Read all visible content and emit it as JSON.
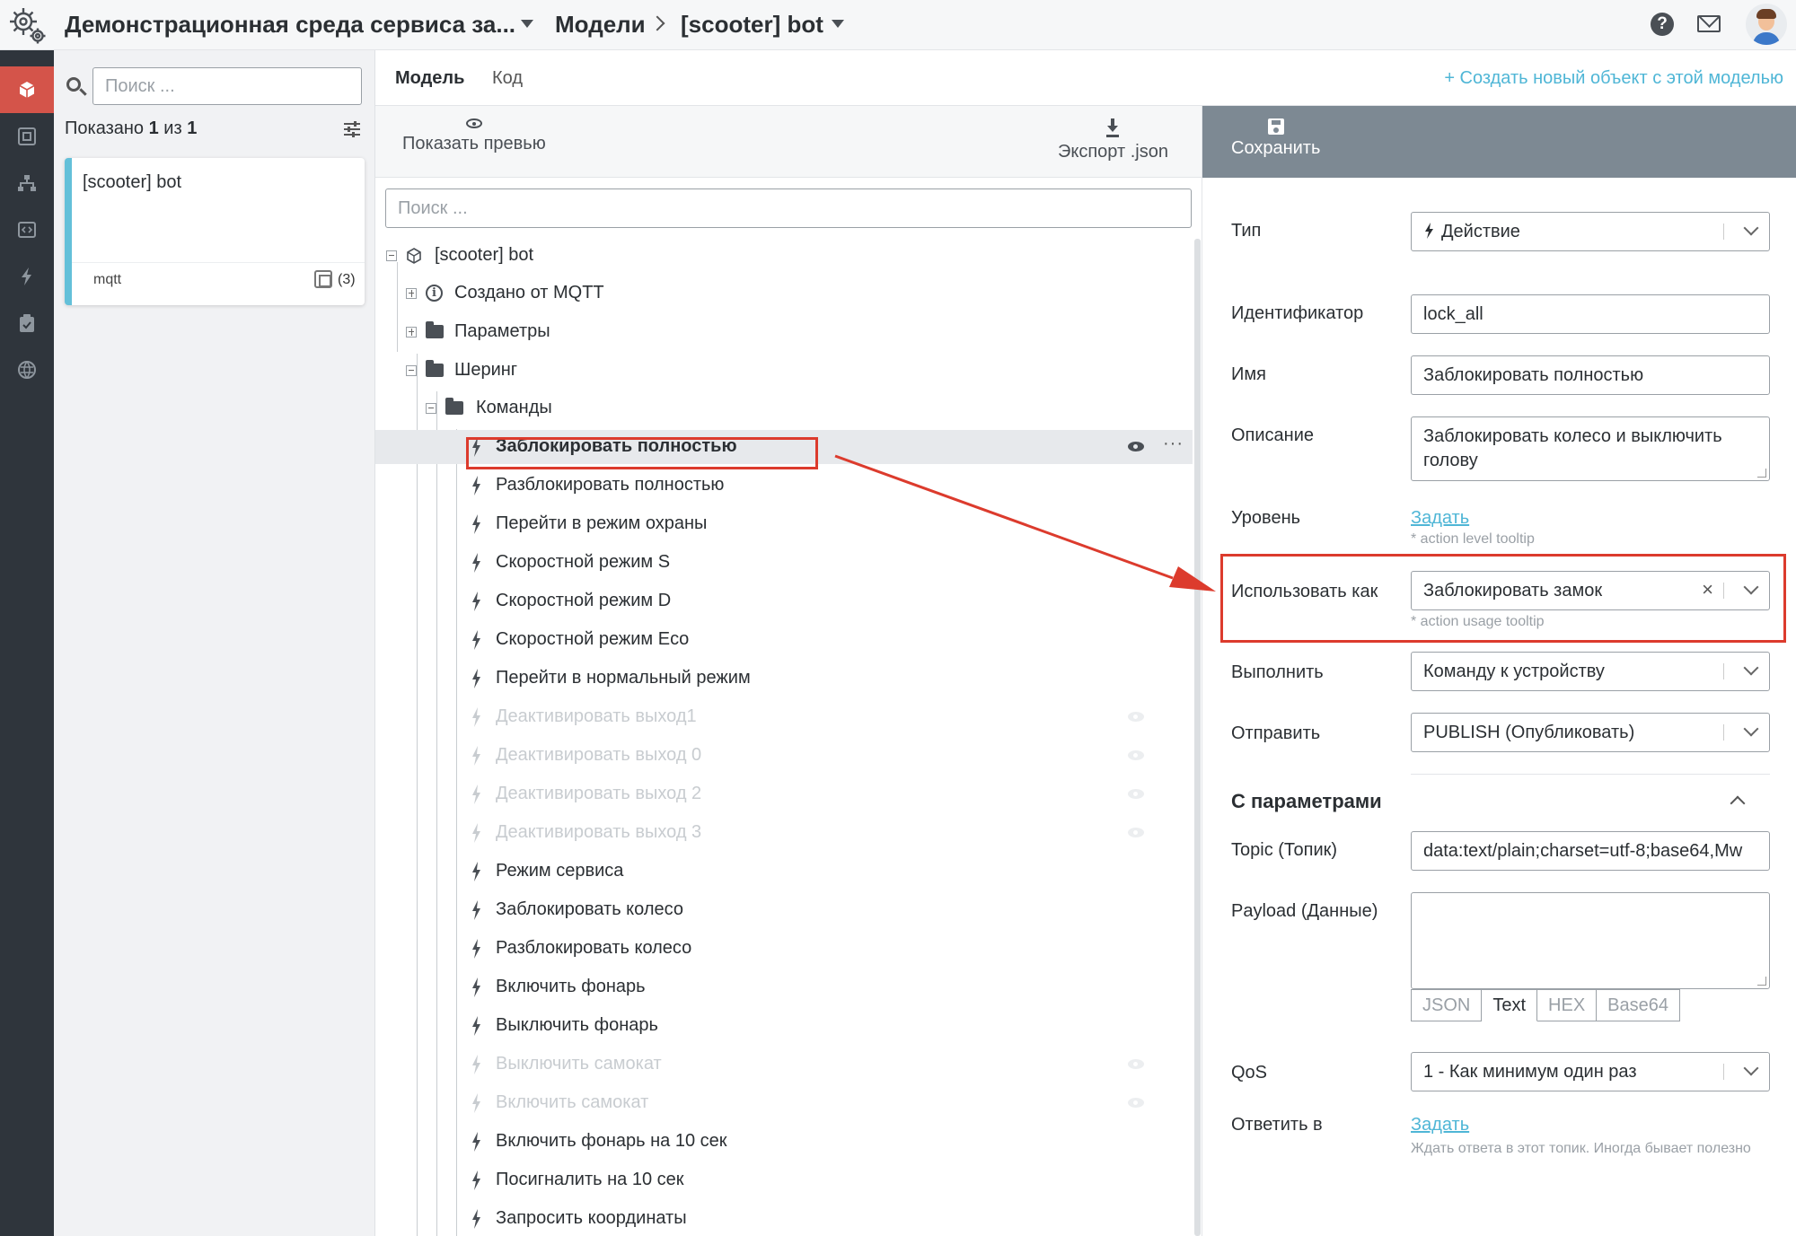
{
  "header": {
    "app_title": "Демонстрационная среда сервиса за...",
    "breadcrumb_models": "Модели",
    "breadcrumb_current": "[scooter] bot",
    "icons": [
      "gear-icon",
      "help-icon",
      "mail-icon",
      "avatar"
    ]
  },
  "nav": {
    "items": [
      "cube-icon",
      "device-icon",
      "hierarchy-icon",
      "code-icon",
      "bolt-icon",
      "clipboard-icon",
      "globe-icon"
    ],
    "active_index": 0,
    "active_color": "#d4544a"
  },
  "models_list": {
    "search_placeholder": "Поиск ...",
    "shown_prefix": "Показано",
    "shown_count": "1",
    "shown_of": "из",
    "shown_total": "1",
    "card": {
      "title": "[scooter] bot",
      "protocol": "mqtt",
      "count": "(3)"
    }
  },
  "tabs": {
    "model": "Модель",
    "code": "Код",
    "create_link": "+ Создать новый объект с этой моделью"
  },
  "toolbar": {
    "preview": "Показать превью",
    "export": "Экспорт .json",
    "save": "Сохранить"
  },
  "tree": {
    "search_placeholder": "Поиск ...",
    "root": "[scooter] bot",
    "nodes": {
      "created": "Создано от MQTT",
      "params": "Параметры",
      "sharing": "Шеринг",
      "commands": "Команды"
    },
    "commands": [
      {
        "label": "Заблокировать полностью",
        "dim": false,
        "selected": true
      },
      {
        "label": "Разблокировать полностью",
        "dim": false
      },
      {
        "label": "Перейти в режим охраны",
        "dim": false
      },
      {
        "label": "Скоростной режим S",
        "dim": false
      },
      {
        "label": "Скоростной режим D",
        "dim": false
      },
      {
        "label": "Скоростной режим Eco",
        "dim": false
      },
      {
        "label": "Перейти в нормальный режим",
        "dim": false
      },
      {
        "label": "Деактивировать выход1",
        "dim": true
      },
      {
        "label": "Деактивировать выход 0",
        "dim": true
      },
      {
        "label": "Деактивировать выход 2",
        "dim": true
      },
      {
        "label": "Деактивировать выход 3",
        "dim": true
      },
      {
        "label": "Режим сервиса",
        "dim": false
      },
      {
        "label": "Заблокировать колесо",
        "dim": false
      },
      {
        "label": "Разблокировать колесо",
        "dim": false
      },
      {
        "label": "Включить фонарь",
        "dim": false
      },
      {
        "label": "Выключить фонарь",
        "dim": false
      },
      {
        "label": "Выключить самокат",
        "dim": true
      },
      {
        "label": "Включить самокат",
        "dim": true
      },
      {
        "label": "Включить фонарь на 10 сек",
        "dim": false
      },
      {
        "label": "Посигналить на 10 сек",
        "dim": false
      },
      {
        "label": "Запросить координаты",
        "dim": false
      }
    ],
    "more_label": "···"
  },
  "props": {
    "type_label": "Тип",
    "type_value": "Действие",
    "id_label": "Идентификатор",
    "id_value": "lock_all",
    "name_label": "Имя",
    "name_value": "Заблокировать полностью",
    "desc_label": "Описание",
    "desc_value": "Заблокировать колесо и выключить голову",
    "level_label": "Уровень",
    "level_link": "Задать",
    "level_hint": "* action level tooltip",
    "use_as_label": "Использовать как",
    "use_as_value": "Заблокировать замок",
    "use_as_hint": "* action usage tooltip",
    "execute_label": "Выполнить",
    "execute_value": "Команду к устройству",
    "send_label": "Отправить",
    "send_value": "PUBLISH (Опубликовать)",
    "params_title": "С параметрами",
    "topic_label": "Topic (Топик)",
    "topic_value": "data:text/plain;charset=utf-8;base64,Mw",
    "payload_label": "Payload (Данные)",
    "payload_value": "",
    "formats": [
      "JSON",
      "Text",
      "HEX",
      "Base64"
    ],
    "active_format": "Text",
    "qos_label": "QoS",
    "qos_value": "1 - Как минимум один раз",
    "reply_label": "Ответить в",
    "reply_link": "Задать",
    "reply_hint": "Ждать ответа в этот топик. Иногда бывает полезно"
  },
  "colors": {
    "accent_link": "#4fb6d6",
    "annotation": "#dc3b2d",
    "save_bar": "#7d8993",
    "card_stripe": "#63c0d9"
  }
}
